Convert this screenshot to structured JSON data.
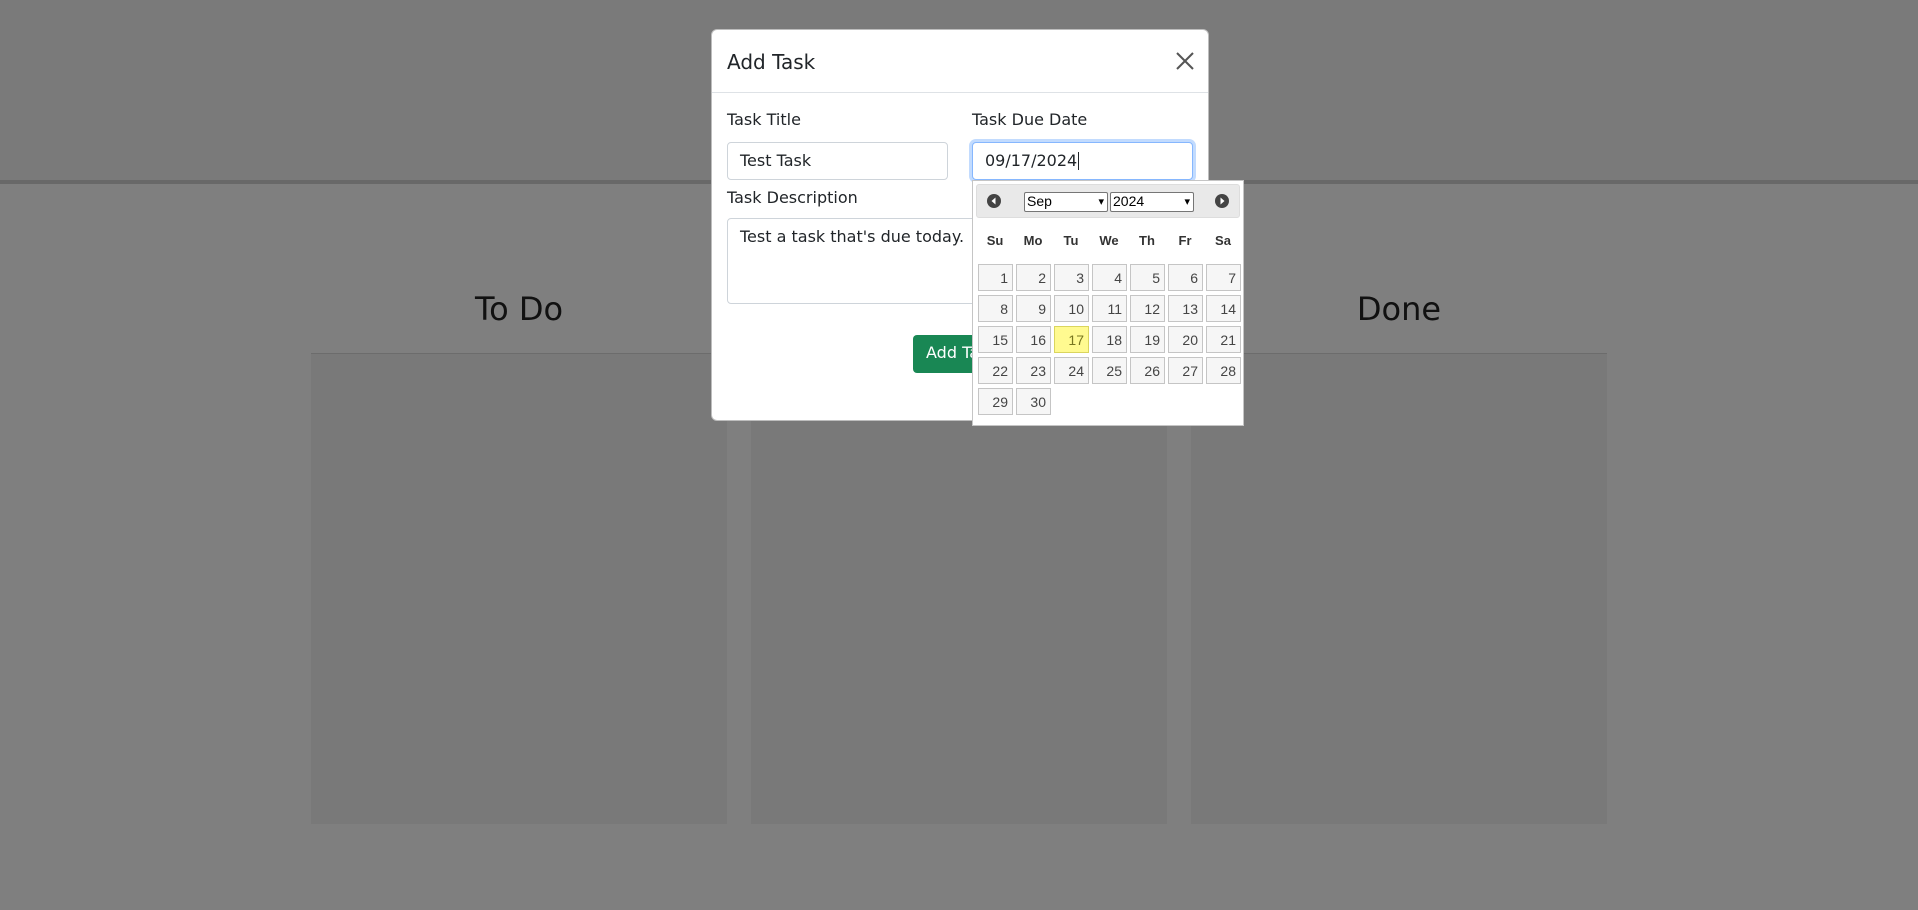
{
  "board": {
    "columns": [
      {
        "title": "To Do"
      },
      {
        "title": ""
      },
      {
        "title": "Done"
      }
    ]
  },
  "modal": {
    "title": "Add Task",
    "fields": {
      "title_label": "Task Title",
      "title_value": "Test Task",
      "due_label": "Task Due Date",
      "due_value": "09/17/2024",
      "desc_label": "Task Description",
      "desc_value": "Test a task that's due today."
    },
    "submit_label": "Add Task"
  },
  "datepicker": {
    "month": "Sep",
    "year": "2024",
    "weekdays": [
      "Su",
      "Mo",
      "Tu",
      "We",
      "Th",
      "Fr",
      "Sa"
    ],
    "days": [
      "1",
      "2",
      "3",
      "4",
      "5",
      "6",
      "7",
      "8",
      "9",
      "10",
      "11",
      "12",
      "13",
      "14",
      "15",
      "16",
      "17",
      "18",
      "19",
      "20",
      "21",
      "22",
      "23",
      "24",
      "25",
      "26",
      "27",
      "28",
      "29",
      "30"
    ],
    "selected_day": "17",
    "highlight_color": "#fffa90"
  },
  "colors": {
    "primary_button": "#198754",
    "focus_border": "#86b7fe"
  }
}
